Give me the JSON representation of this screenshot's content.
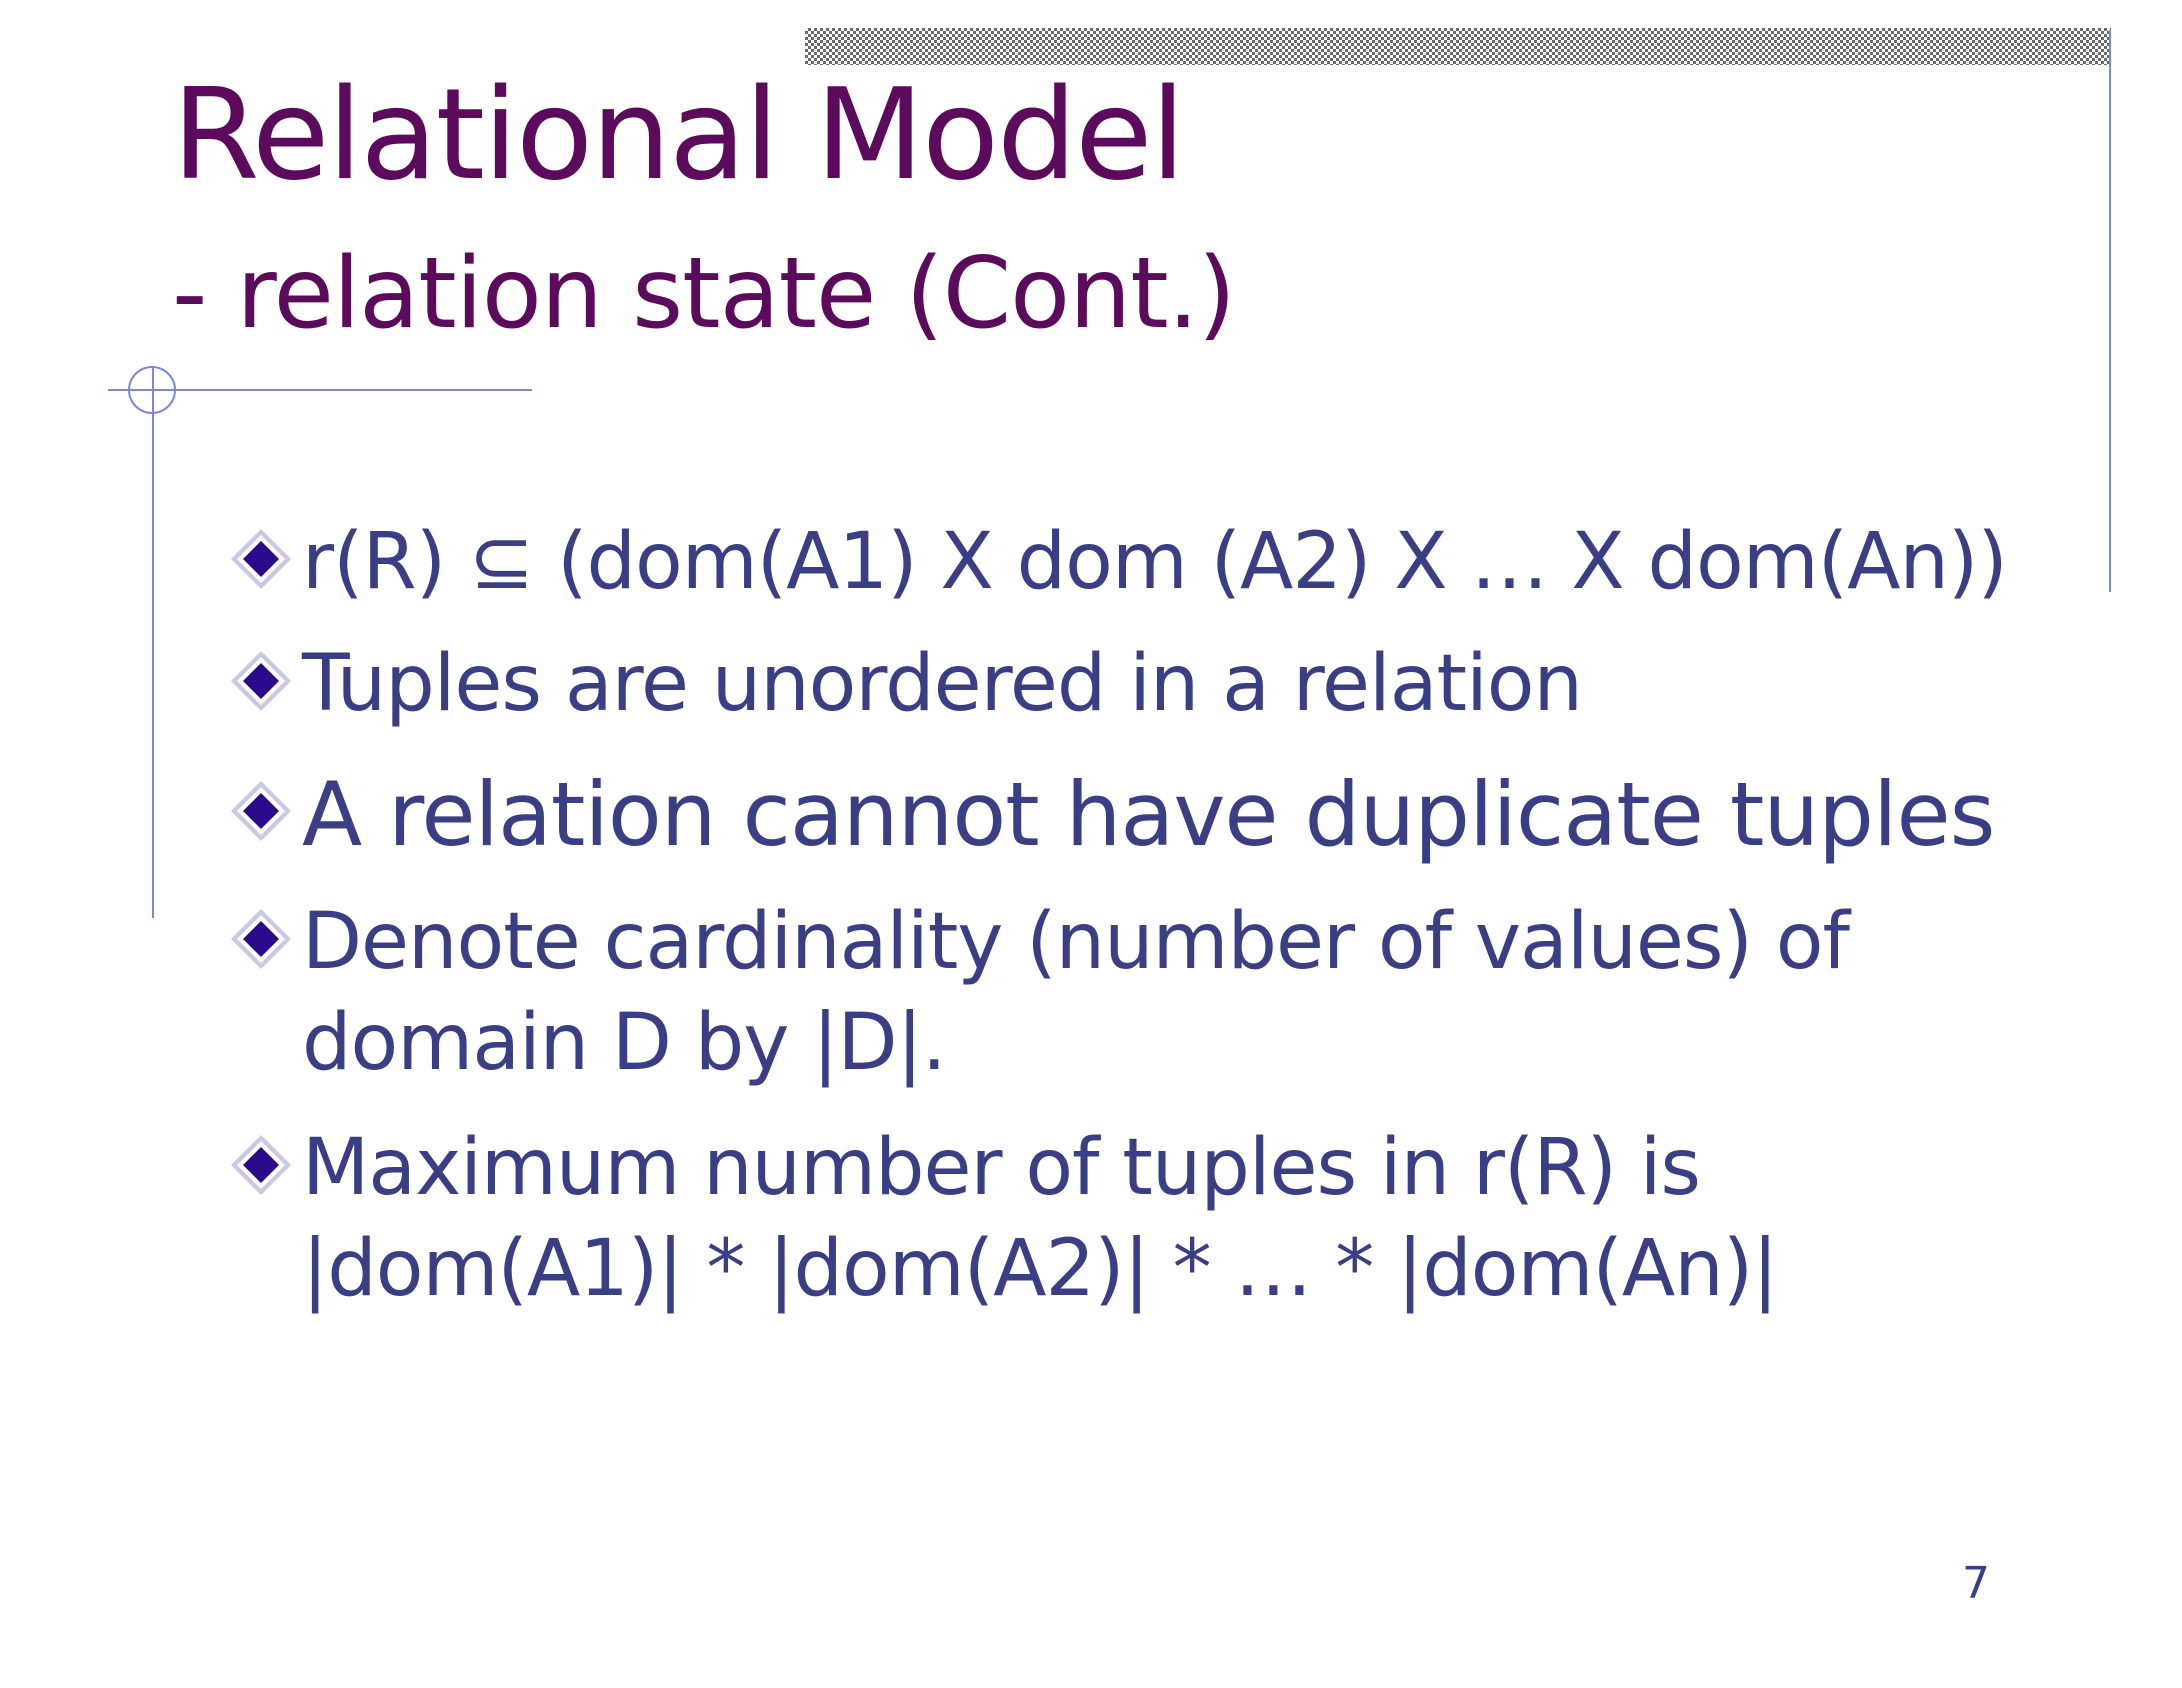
{
  "slide": {
    "title": "Relational Model",
    "subtitle": "- relation state (Cont.)",
    "bullets": [
      {
        "text": "r(R) ⊆ (dom(A1) X dom (A2) X … X dom(An))"
      },
      {
        "text": "Tuples are unordered in a relation"
      },
      {
        "text": "A relation cannot have duplicate tuples"
      },
      {
        "lines": [
          "Denote cardinality (number of values) of",
          "domain D by |D|."
        ]
      },
      {
        "lines": [
          "Maximum number of tuples in r(R) is",
          "|dom(A1)| * |dom(A2)| * … * |dom(An)|"
        ]
      }
    ],
    "page_number": "7"
  },
  "colors": {
    "title": "#5c0a5c",
    "body_text": "#3a3f85",
    "accent_lines": "#7f86d8",
    "bullet": "#2a0a8a"
  },
  "icons": {
    "bullet": "diamond-bullet-icon",
    "corner_mark": "crosshair-circle-icon"
  }
}
